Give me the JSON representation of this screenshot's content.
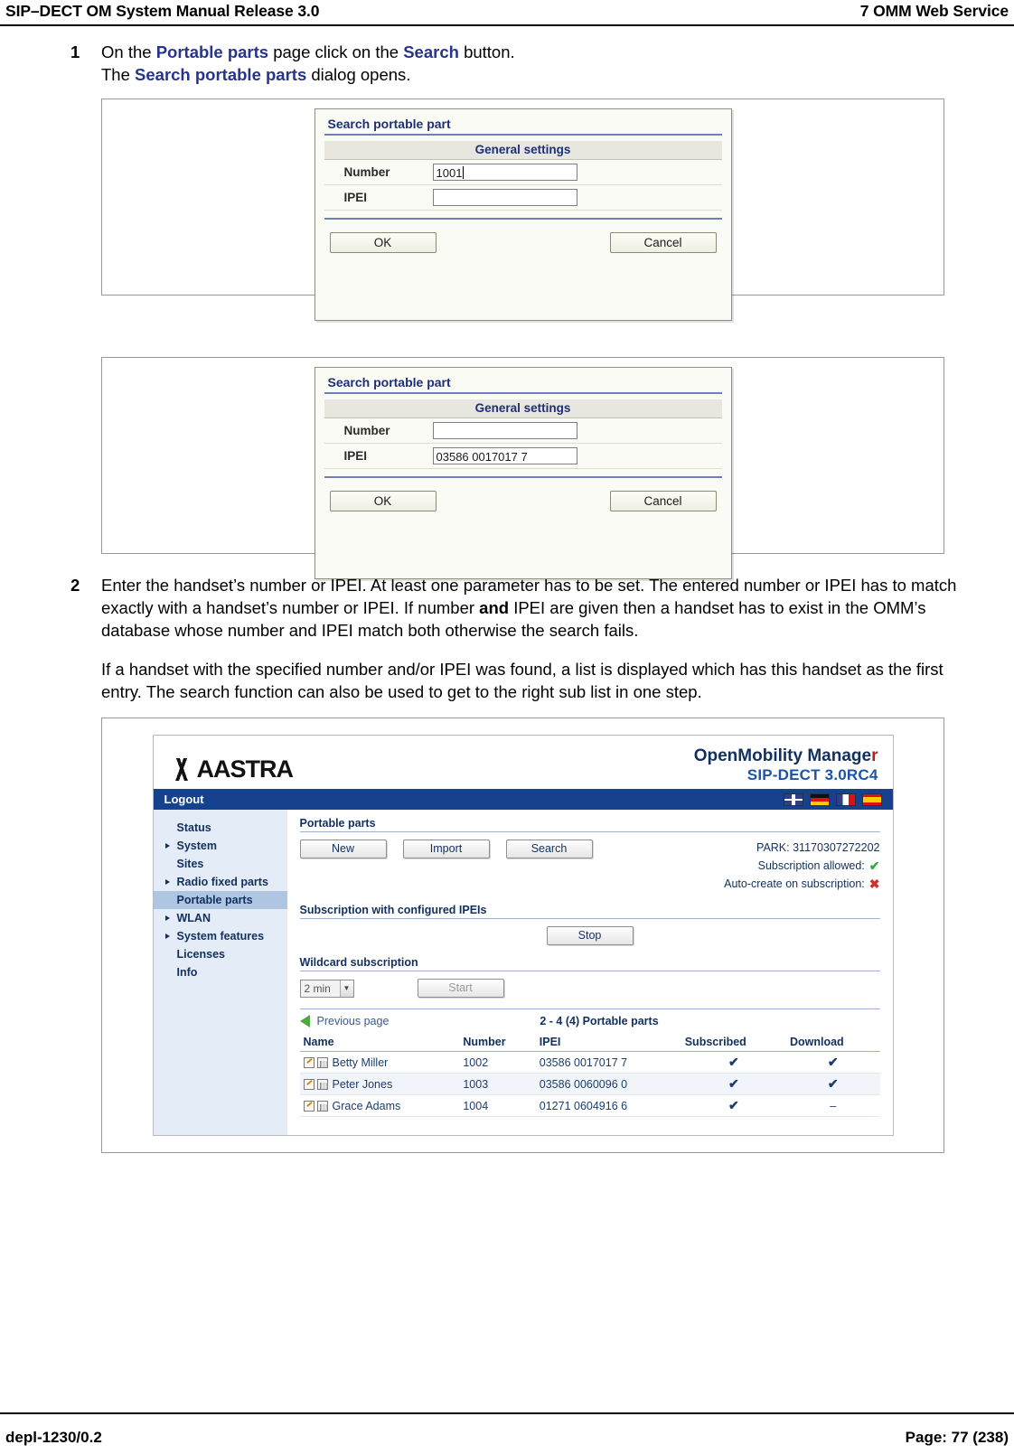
{
  "header": {
    "left": "SIP–DECT OM System Manual Release 3.0",
    "right": "7 OMM Web Service"
  },
  "footer": {
    "left": "depl-1230/0.2",
    "right": "Page: 77 (238)"
  },
  "steps": [
    {
      "num": "1",
      "line1_pre": "On the ",
      "line1_link1": "Portable parts",
      "line1_mid": " page click on the ",
      "line1_link2": "Search",
      "line1_post": " button.",
      "line2_pre": "The ",
      "line2_link": "Search portable parts",
      "line2_post": " dialog opens."
    },
    {
      "num": "2",
      "text_a": "Enter the handset’s number or IPEI. At least one parameter has to be set. The entered number or IPEI has to match exactly with a handset’s number or IPEI. If number ",
      "text_bold": "and",
      "text_b": " IPEI are given then a handset has to exist in the OMM’s database whose number and IPEI match both otherwise the search fails."
    }
  ],
  "paragraph": "If a handset with the specified number and/or IPEI was found, a list is displayed which has this handset as the first entry. The search function can also be used to get to the right sub list in one step.",
  "dialog1": {
    "title": "Search portable part",
    "section": "General settings",
    "fields": [
      {
        "label": "Number",
        "value": "1001"
      },
      {
        "label": "IPEI",
        "value": ""
      }
    ],
    "ok": "OK",
    "cancel": "Cancel"
  },
  "dialog2": {
    "title": "Search portable part",
    "section": "General settings",
    "fields": [
      {
        "label": "Number",
        "value": ""
      },
      {
        "label": "IPEI",
        "value": "03586 0017017 7"
      }
    ],
    "ok": "OK",
    "cancel": "Cancel"
  },
  "omm": {
    "logo": "AASTRA",
    "product_title": "OpenMobility Manage",
    "product_title_last": "r",
    "product_version": "SIP-DECT 3.0RC4",
    "logout": "Logout",
    "nav": [
      {
        "label": "Status",
        "arrow": false,
        "selected": false
      },
      {
        "label": "System",
        "arrow": true,
        "selected": false
      },
      {
        "label": "Sites",
        "arrow": false,
        "selected": false
      },
      {
        "label": "Radio fixed parts",
        "arrow": true,
        "selected": false
      },
      {
        "label": "Portable parts",
        "arrow": false,
        "selected": true
      },
      {
        "label": "WLAN",
        "arrow": true,
        "selected": false
      },
      {
        "label": "System features",
        "arrow": true,
        "selected": false
      },
      {
        "label": "Licenses",
        "arrow": false,
        "selected": false
      },
      {
        "label": "Info",
        "arrow": false,
        "selected": false
      }
    ],
    "section_title": "Portable parts",
    "buttons": {
      "new": "New",
      "import": "Import",
      "search": "Search"
    },
    "park": "PARK: 31170307272202",
    "subscription_allowed_label": "Subscription allowed:",
    "autocreate_label": "Auto-create on subscription:",
    "subscription_ipei_title": "Subscription with configured IPEIs",
    "stop_button": "Stop",
    "wildcard_title": "Wildcard subscription",
    "wildcard_time": "2 min",
    "start_button": "Start",
    "previous_page": "Previous page",
    "page_info": "2 - 4 (4) Portable parts",
    "table": {
      "columns": [
        "Name",
        "Number",
        "IPEI",
        "Subscribed",
        "Download"
      ],
      "rows": [
        {
          "name": "Betty Miller",
          "number": "1002",
          "ipei": "03586 0017017 7",
          "subscribed": "✔",
          "download": "✔"
        },
        {
          "name": "Peter Jones",
          "number": "1003",
          "ipei": "03586 0060096 0",
          "subscribed": "✔",
          "download": "✔"
        },
        {
          "name": "Grace Adams",
          "number": "1004",
          "ipei": "01271 0604916 6",
          "subscribed": "✔",
          "download": "–"
        }
      ]
    }
  }
}
